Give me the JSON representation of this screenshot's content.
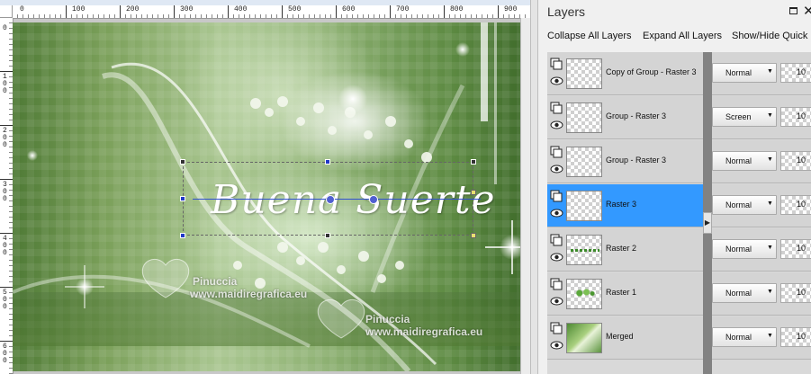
{
  "ruler": {
    "top_labels": [
      "0",
      "100",
      "200",
      "300",
      "400",
      "500",
      "600",
      "700",
      "800",
      "900"
    ],
    "left_labels": [
      "0",
      "100",
      "200",
      "300",
      "400",
      "500",
      "600"
    ]
  },
  "canvas": {
    "title_text": "Buena Suerte",
    "watermarks": [
      {
        "name": "Pinuccia",
        "url": "www.maidiregrafica.eu"
      },
      {
        "name": "Pinuccia",
        "url": "www.maidiregrafica.eu"
      }
    ]
  },
  "layers_panel": {
    "title": "Layers",
    "toolbar": {
      "collapse_all": "Collapse All Layers",
      "expand_all": "Expand All Layers",
      "show_hide": "Show/Hide Quick"
    },
    "layers": [
      {
        "name": "Copy of Group - Raster 3",
        "blend": "Normal",
        "opacity": "10",
        "thumb": "empty",
        "selected": false
      },
      {
        "name": "Group - Raster 3",
        "blend": "Screen",
        "opacity": "10",
        "thumb": "empty",
        "selected": false
      },
      {
        "name": "Group - Raster 3",
        "blend": "Normal",
        "opacity": "10",
        "thumb": "empty",
        "selected": false
      },
      {
        "name": "Raster 3",
        "blend": "Normal",
        "opacity": "10",
        "thumb": "empty",
        "selected": true
      },
      {
        "name": "Raster 2",
        "blend": "Normal",
        "opacity": "10",
        "thumb": "line",
        "selected": false
      },
      {
        "name": "Raster 1",
        "blend": "Normal",
        "opacity": "10",
        "thumb": "sprig",
        "selected": false
      },
      {
        "name": "Merged",
        "blend": "Normal",
        "opacity": "10",
        "thumb": "merged",
        "selected": false
      }
    ]
  },
  "colors": {
    "selected_layer": "#3399ff",
    "panel_bg": "#f0f0f0",
    "layer_row_bg": "#d4d4d4"
  }
}
